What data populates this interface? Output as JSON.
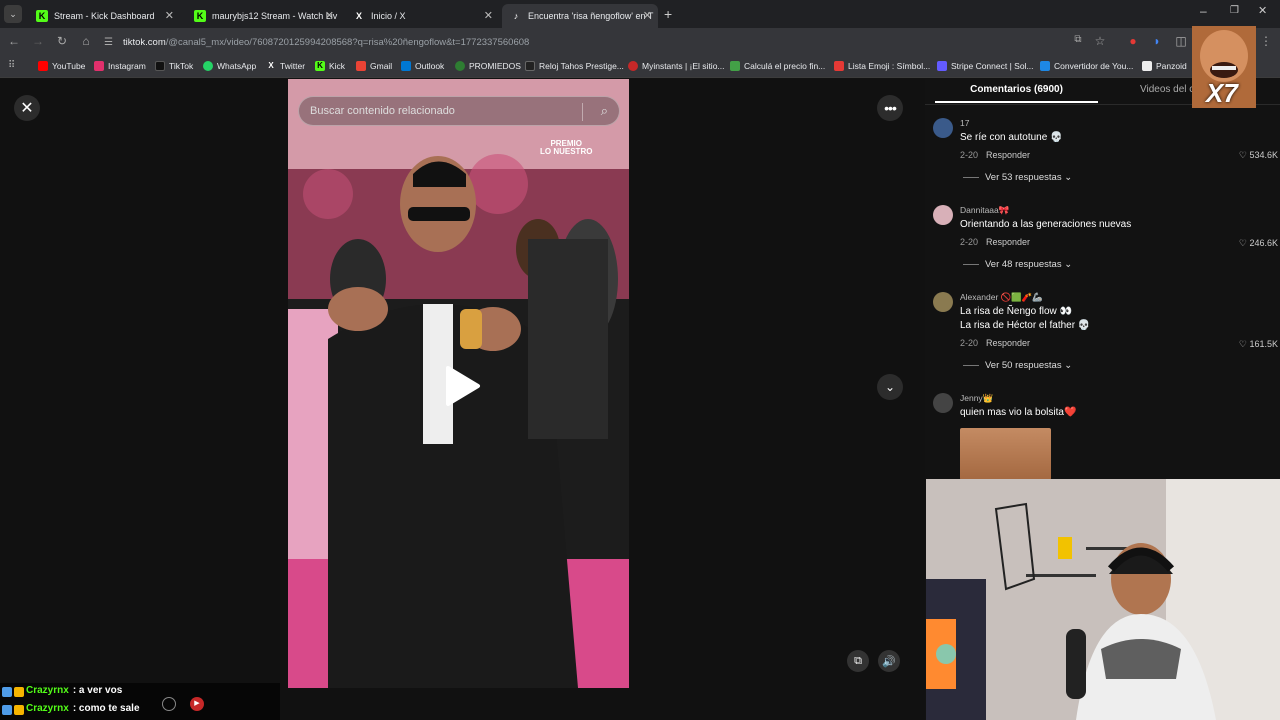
{
  "tabs": [
    {
      "title": "Stream - Kick Dashboard",
      "icon": "K",
      "color": "#53fc18"
    },
    {
      "title": "maurybjs12 Stream - Watch Liv",
      "icon": "K",
      "color": "#53fc18"
    },
    {
      "title": "Inicio / X",
      "icon": "X",
      "color": "#000000"
    },
    {
      "title": "Encuentra 'risa ñengoflow' en T",
      "icon": "♪",
      "color": "#000000"
    }
  ],
  "address": {
    "domain": "tiktok.com",
    "path": "/@canal5_mx/video/7608720125994208568?q=risa%20ñengoflow&t=1772337560608"
  },
  "bookmarks": [
    {
      "label": "YouTube",
      "color": "#ff0000"
    },
    {
      "label": "Instagram",
      "color": "#e1306c"
    },
    {
      "label": "TikTok",
      "color": "#000000"
    },
    {
      "label": "WhatsApp",
      "color": "#25d366"
    },
    {
      "label": "Twitter",
      "color": "#000000"
    },
    {
      "label": "Kick",
      "color": "#53fc18"
    },
    {
      "label": "Gmail",
      "color": "#ea4335"
    },
    {
      "label": "Outlook",
      "color": "#0078d4"
    },
    {
      "label": "PROMIEDOS",
      "color": "#2e7d32"
    },
    {
      "label": "Reloj Tahos Prestige...",
      "color": "#222222"
    },
    {
      "label": "Myinstants | ¡El sitio...",
      "color": "#c62828"
    },
    {
      "label": "Calculá el precio fin...",
      "color": "#43a047"
    },
    {
      "label": "Lista Emoji : Símbol...",
      "color": "#e53935"
    },
    {
      "label": "Stripe Connect | Sol...",
      "color": "#635bff"
    },
    {
      "label": "Convertidor de You...",
      "color": "#1e88e5"
    },
    {
      "label": "Panzoid",
      "color": "#eeeeee"
    }
  ],
  "search": {
    "placeholder": "Buscar contenido relacionado"
  },
  "video": {
    "watermark_line1": "PREMIO",
    "watermark_line2": "LO NUESTRO"
  },
  "comments_panel": {
    "tab_comments": "Comentarios (6900)",
    "tab_videos": "Videos del c",
    "items": [
      {
        "user": "17",
        "text": "Se ríe con autotune 💀",
        "date": "2-20",
        "reply": "Responder",
        "likes": "534.6K",
        "replies": "Ver 53 respuestas",
        "avatar_color": "#3a5a8a"
      },
      {
        "user": "Dannitaaa🎀",
        "text": "Orientando a las generaciones nuevas",
        "date": "2-20",
        "reply": "Responder",
        "likes": "246.6K",
        "replies": "Ver 48 respuestas",
        "avatar_color": "#d8b0b8"
      },
      {
        "user": "Alexander 🚫🟩🧨🦾",
        "text": "La risa de Ñengo flow 👀",
        "text2": "La risa de Héctor el father 💀",
        "date": "2-20",
        "reply": "Responder",
        "likes": "161.5K",
        "replies": "Ver 50 respuestas",
        "avatar_color": "#8a7a50"
      },
      {
        "user": "Jenny👑",
        "text": "quien mas vio la bolsita❤️",
        "avatar_color": "#444444"
      }
    ]
  },
  "chat": [
    {
      "user": "Crazyrnx",
      "msg": ": a ver vos"
    },
    {
      "user": "Crazyrnx",
      "msg": ": como te sale"
    }
  ],
  "overlay": {
    "multiplier": "X7"
  }
}
